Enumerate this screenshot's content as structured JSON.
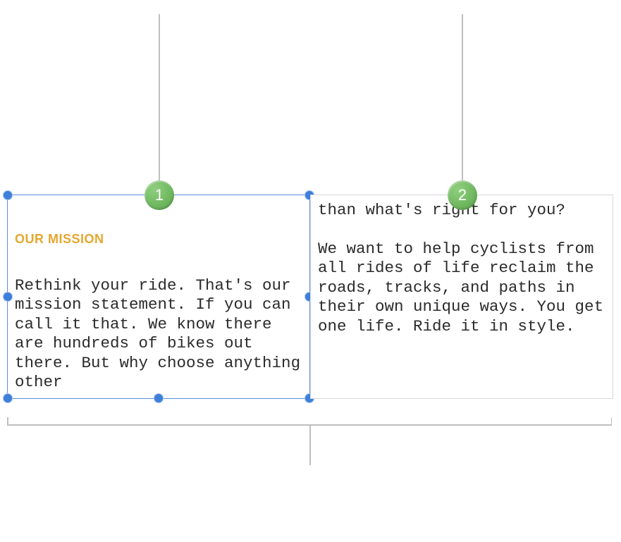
{
  "callouts": {
    "one": "1",
    "two": "2"
  },
  "textbox_left": {
    "heading": "OUR MISSION",
    "body": "Rethink your ride. That's our mission statement. If you can call it that. We know there are hundreds of bikes out there. But why choose anything other"
  },
  "textbox_right": {
    "body": "than what's right for you?\n\nWe want to help cyclists from all rides of life reclaim the roads, tracks, and paths in their own unique ways. You get one life. Ride it in style."
  },
  "colors": {
    "selection_border": "#5a8fd6",
    "handle": "#3d7fd9",
    "badge": "#6fb75f",
    "heading": "#e6a72e",
    "leader": "#bfbfbf"
  }
}
